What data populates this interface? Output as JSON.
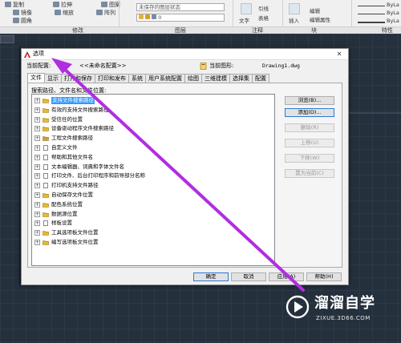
{
  "ribbon": {
    "row1": [
      "复制",
      "拉伸",
      "图案"
    ],
    "row2": [
      "镜像",
      "缩放",
      "阵列"
    ],
    "row3": [
      "圆角",
      "",
      ""
    ],
    "layer_state": "未保存的图层状态",
    "layer_current": "0",
    "text_label": "文字",
    "annotate_items": [
      "引线",
      "表格"
    ],
    "insert_label": "插入",
    "block_items": [
      "编辑",
      "编辑属性"
    ],
    "props_items": [
      "ByLa",
      "ByLa",
      "ByLa"
    ],
    "groups": [
      "修改",
      "图层",
      "注释",
      "块",
      "特性"
    ]
  },
  "dialog": {
    "title": "选项",
    "profile_label": "当前配置:",
    "profile_value": "<<未命名配置>>",
    "drawing_label": "当前图形:",
    "drawing_value": "Drawing1.dwg",
    "tabs": [
      "文件",
      "显示",
      "打开和保存",
      "打印和发布",
      "系统",
      "用户系统配置",
      "绘图",
      "三维建模",
      "选择集",
      "配置"
    ],
    "active_tab": "文件",
    "tree_label": "搜索路径、文件名和文件位置:",
    "tree_items": [
      {
        "text": "支持文件搜索路径",
        "icon": "folder-icon",
        "selected": true
      },
      {
        "text": "有效的支持文件搜索路径",
        "icon": "folder-icon",
        "selected": false
      },
      {
        "text": "受信任的位置",
        "icon": "folder-icon",
        "selected": false
      },
      {
        "text": "设备驱动程序文件搜索路径",
        "icon": "folder-icon",
        "selected": false
      },
      {
        "text": "工程文件搜索路径",
        "icon": "project-icon",
        "selected": false
      },
      {
        "text": "自定义文件",
        "icon": "file-icon",
        "selected": false
      },
      {
        "text": "帮助和其他文件名",
        "icon": "file-icon",
        "selected": false
      },
      {
        "text": "文本编辑器、词典和字体文件名",
        "icon": "file-icon",
        "selected": false
      },
      {
        "text": "打印文件、后台打印程序和前导部分名称",
        "icon": "file-icon",
        "selected": false
      },
      {
        "text": "打印机支持文件路径",
        "icon": "file-icon",
        "selected": false
      },
      {
        "text": "自动保存文件位置",
        "icon": "folder-icon",
        "selected": false
      },
      {
        "text": "配色系统位置",
        "icon": "folder-icon",
        "selected": false
      },
      {
        "text": "数据源位置",
        "icon": "folder-icon",
        "selected": false
      },
      {
        "text": "样板设置",
        "icon": "file-icon",
        "selected": false
      },
      {
        "text": "工具选项板文件位置",
        "icon": "folder-icon",
        "selected": false
      },
      {
        "text": "编写选项板文件位置",
        "icon": "folder-icon",
        "selected": false
      }
    ],
    "side_buttons": [
      {
        "label": "浏览(B)...",
        "disabled": false
      },
      {
        "label": "添加(D)...",
        "disabled": false
      },
      {
        "label": "删除(R)",
        "disabled": true
      },
      {
        "label": "上移(U)",
        "disabled": true
      },
      {
        "label": "下移(W)",
        "disabled": true
      },
      {
        "label": "置为当前(C)",
        "disabled": true
      }
    ],
    "footer_buttons": [
      "确定",
      "取消",
      "应用(A)",
      "帮助(H)"
    ]
  },
  "watermark": {
    "cn": "溜溜自学",
    "en": "ZIXUE.3D66.COM"
  },
  "colors": {
    "canvas_bg": "#25303d",
    "arrow": "#b02ee0",
    "selection": "#3399ff"
  }
}
